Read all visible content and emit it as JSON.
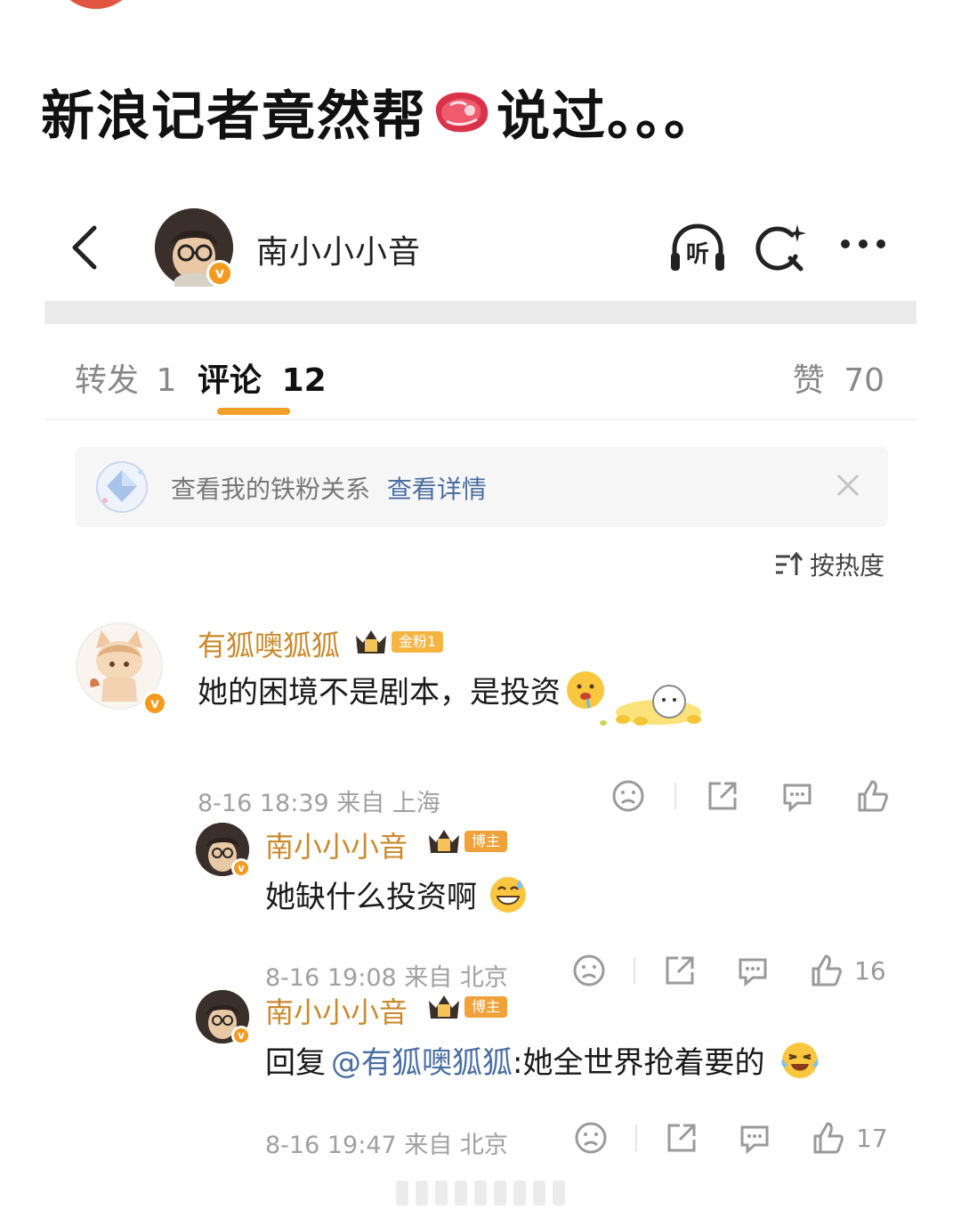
{
  "headline": {
    "before": "新浪记者竟然帮",
    "emoji": "meat-icon",
    "after": "说过。。。"
  },
  "topbar": {
    "name": "南小小小音",
    "listen_label": "听"
  },
  "tabs": [
    {
      "label": "转发",
      "count": "1"
    },
    {
      "label": "评论",
      "count": "12"
    },
    {
      "label": "赞",
      "count": "70"
    }
  ],
  "fan_banner": {
    "text": "查看我的铁粉关系",
    "link": "查看详情"
  },
  "sort": {
    "label": "按热度"
  },
  "comments": [
    {
      "user": "有狐噢狐狐",
      "tag": "金粉1",
      "text": "她的困境不是剧本，是投资",
      "meta": "8-16 18:39 来自 上海",
      "likes": "",
      "colors": {
        "name": "#c98a2c"
      }
    },
    {
      "user": "南小小小音",
      "tag": "博主",
      "text": "她缺什么投资啊",
      "meta": "8-16 19:08 来自 北京",
      "likes": "16"
    },
    {
      "user": "南小小小音",
      "tag": "博主",
      "reply_prefix": "回复",
      "mention": "@有狐噢狐狐",
      "text": ":她全世界抢着要的",
      "meta": "8-16 19:47 来自 北京",
      "likes": "17"
    }
  ],
  "colors": {
    "accent": "#f3a029",
    "link": "#4a6ea2",
    "vip": "#f49a1f"
  }
}
